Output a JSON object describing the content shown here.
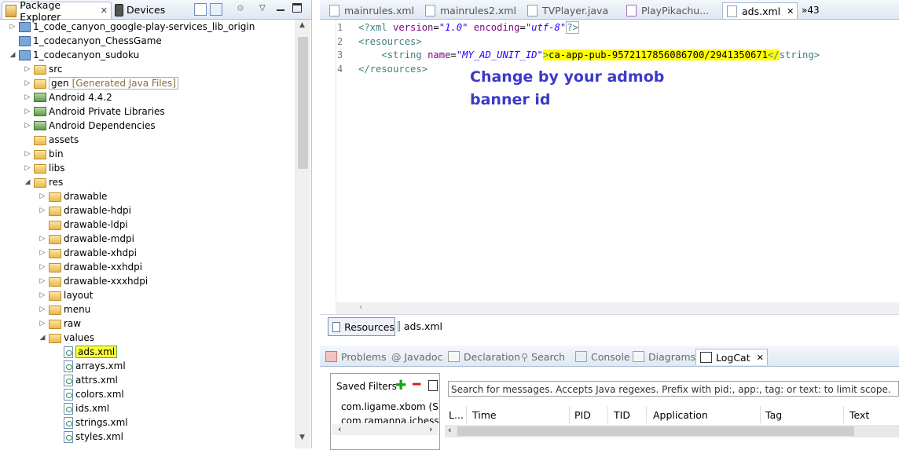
{
  "left_panel": {
    "tabs": [
      {
        "label": "Package Explorer",
        "icon": "package-explorer-icon"
      },
      {
        "label": "Devices",
        "icon": "device-icon"
      }
    ],
    "tree": [
      {
        "label": "1_code_canyon_google-play-services_lib_origin",
        "icon": "project-icon",
        "level": 0,
        "expander": "collapsed"
      },
      {
        "label": "1_codecanyon_ChessGame",
        "icon": "closed-project-icon",
        "level": 0,
        "expander": "none"
      },
      {
        "label": "1_codecanyon_sudoku",
        "icon": "project-icon",
        "level": 0,
        "expander": "expanded"
      },
      {
        "label": "src",
        "icon": "source-folder-icon",
        "level": 1,
        "expander": "collapsed"
      },
      {
        "label": "gen",
        "suffix": "[Generated Java Files]",
        "icon": "source-folder-icon",
        "level": 1,
        "expander": "collapsed"
      },
      {
        "label": "Android 4.4.2",
        "icon": "library-icon",
        "level": 1,
        "expander": "collapsed"
      },
      {
        "label": "Android Private Libraries",
        "icon": "library-icon",
        "level": 1,
        "expander": "collapsed"
      },
      {
        "label": "Android Dependencies",
        "icon": "library-icon",
        "level": 1,
        "expander": "collapsed"
      },
      {
        "label": "assets",
        "icon": "folder-icon",
        "level": 1,
        "expander": "none"
      },
      {
        "label": "bin",
        "icon": "folder-icon",
        "level": 1,
        "expander": "collapsed"
      },
      {
        "label": "libs",
        "icon": "folder-icon",
        "level": 1,
        "expander": "collapsed"
      },
      {
        "label": "res",
        "icon": "folder-icon",
        "level": 1,
        "expander": "expanded"
      },
      {
        "label": "drawable",
        "icon": "folder-icon",
        "level": 2,
        "expander": "collapsed"
      },
      {
        "label": "drawable-hdpi",
        "icon": "folder-icon",
        "level": 2,
        "expander": "collapsed"
      },
      {
        "label": "drawable-ldpi",
        "icon": "folder-icon",
        "level": 2,
        "expander": "none"
      },
      {
        "label": "drawable-mdpi",
        "icon": "folder-icon",
        "level": 2,
        "expander": "collapsed"
      },
      {
        "label": "drawable-xhdpi",
        "icon": "folder-icon",
        "level": 2,
        "expander": "collapsed"
      },
      {
        "label": "drawable-xxhdpi",
        "icon": "folder-icon",
        "level": 2,
        "expander": "collapsed"
      },
      {
        "label": "drawable-xxxhdpi",
        "icon": "folder-icon",
        "level": 2,
        "expander": "collapsed"
      },
      {
        "label": "layout",
        "icon": "folder-icon",
        "level": 2,
        "expander": "collapsed"
      },
      {
        "label": "menu",
        "icon": "folder-icon",
        "level": 2,
        "expander": "collapsed"
      },
      {
        "label": "raw",
        "icon": "folder-icon",
        "level": 2,
        "expander": "collapsed"
      },
      {
        "label": "values",
        "icon": "folder-icon",
        "level": 2,
        "expander": "expanded"
      },
      {
        "label": "ads.xml",
        "icon": "xml-file-icon",
        "level": 3,
        "expander": "none",
        "selected": true
      },
      {
        "label": "arrays.xml",
        "icon": "xml-file-icon",
        "level": 3,
        "expander": "none"
      },
      {
        "label": "attrs.xml",
        "icon": "xml-file-icon",
        "level": 3,
        "expander": "none"
      },
      {
        "label": "colors.xml",
        "icon": "xml-file-icon",
        "level": 3,
        "expander": "none"
      },
      {
        "label": "ids.xml",
        "icon": "xml-file-icon",
        "level": 3,
        "expander": "none"
      },
      {
        "label": "strings.xml",
        "icon": "xml-file-icon",
        "level": 3,
        "expander": "none"
      },
      {
        "label": "styles.xml",
        "icon": "xml-file-icon",
        "level": 3,
        "expander": "none"
      }
    ]
  },
  "editor": {
    "tabs": [
      {
        "label": "mainrules.xml",
        "active": false
      },
      {
        "label": "mainrules2.xml",
        "active": false
      },
      {
        "label": "TVPlayer.java",
        "active": false
      },
      {
        "label": "PlayPikachu...",
        "active": false
      },
      {
        "label": "ads.xml",
        "active": true
      }
    ],
    "overflow": "»43",
    "lines": [
      {
        "no": "1"
      },
      {
        "no": "2"
      },
      {
        "no": "3"
      },
      {
        "no": "4"
      }
    ],
    "code": {
      "l1_open": "<?xml ",
      "l1_attr1": "version",
      "l1_eq1": "=",
      "l1_val1": "\"1.0\"",
      "l1_sp": " ",
      "l1_attr2": "encoding",
      "l1_eq2": "=",
      "l1_val2": "\"utf-8\"",
      "l1_close": "?>",
      "l2": "<resources>",
      "l3_indent": "    ",
      "l3_open": "<string ",
      "l3_attr": "name",
      "l3_eq": "=",
      "l3_val": "\"MY_AD_UNIT_ID\"",
      "l3_gt": ">",
      "l3_text": "ca-app-pub-9572117856086700/2941350671",
      "l3_endopen": "</",
      "l3_endname": "string>",
      "l4": "</resources>"
    },
    "annotation": [
      "Change by your admob",
      "banner id"
    ],
    "bottom_tabs": [
      {
        "label": "Resources",
        "icon": "resources-icon"
      },
      {
        "label": "ads.xml",
        "icon": "xml-file-icon"
      }
    ]
  },
  "views": {
    "tabs": [
      {
        "label": "Problems",
        "icon": "problems-icon"
      },
      {
        "label": "Javadoc",
        "icon": "javadoc-icon"
      },
      {
        "label": "Declaration",
        "icon": "declaration-icon"
      },
      {
        "label": "Search",
        "icon": "search-icon"
      },
      {
        "label": "Console",
        "icon": "console-icon"
      },
      {
        "label": "Diagrams",
        "icon": "diagrams-icon"
      },
      {
        "label": "LogCat",
        "icon": "logcat-icon",
        "active": true
      }
    ],
    "logcat": {
      "saved_filters_label": "Saved Filters",
      "filters": [
        "com.ligame.xbom (Se",
        "com.ramanna.ichess ("
      ],
      "search_placeholder": "Search for messages. Accepts Java regexes. Prefix with pid:, app:, tag: or text: to limit scope.",
      "columns": [
        "L...",
        "Time",
        "PID",
        "TID",
        "Application",
        "Tag",
        "Text"
      ]
    }
  },
  "colors": {
    "tab_bar_top": "#f4f7fb",
    "tab_bar_bottom": "#dfe8f3",
    "selection_highlight": "#ffff33",
    "annotation_text": "#3a3acc",
    "xml_tag": "#3f7f7f",
    "xml_attr": "#7f007f",
    "xml_value": "#2a00ff"
  }
}
